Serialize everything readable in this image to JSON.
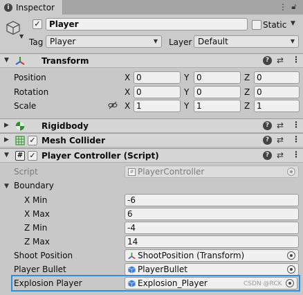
{
  "tab": {
    "title": "Inspector",
    "info_icon": "info-icon",
    "menu_icon": "kebab-menu-icon",
    "lock_icon": "lock-icon"
  },
  "gameobject": {
    "name": "Player",
    "active": true,
    "static_label": "Static",
    "static": false,
    "tag_label": "Tag",
    "tag": "Player",
    "layer_label": "Layer",
    "layer": "Default"
  },
  "transform": {
    "title": "Transform",
    "rows": [
      {
        "label": "Position",
        "x": "0",
        "y": "0",
        "z": "0"
      },
      {
        "label": "Rotation",
        "x": "0",
        "y": "0",
        "z": "0"
      },
      {
        "label": "Scale",
        "x": "1",
        "y": "1",
        "z": "1"
      }
    ],
    "axis": [
      "X",
      "Y",
      "Z"
    ]
  },
  "rigidbody": {
    "title": "Rigidbody"
  },
  "mesh_collider": {
    "title": "Mesh Collider",
    "enabled": true
  },
  "player_controller": {
    "title": "Player Controller (Script)",
    "enabled": true,
    "script_label": "Script",
    "script_value": "PlayerController",
    "boundary_label": "Boundary",
    "boundary": [
      {
        "label": "X Min",
        "value": "-6"
      },
      {
        "label": "X Max",
        "value": "6"
      },
      {
        "label": "Z Min",
        "value": "-4"
      },
      {
        "label": "Z Max",
        "value": "14"
      }
    ],
    "shoot_position_label": "Shoot Position",
    "shoot_position_value": "ShootPosition (Transform)",
    "player_bullet_label": "Player Bullet",
    "player_bullet_value": "PlayerBullet",
    "explosion_player_label": "Explosion Player",
    "explosion_player_value": "Explosion_Player"
  },
  "watermark": "CSDN @RCK",
  "colors": {
    "highlight": "#2c8de6",
    "background": "#c8c8c8"
  }
}
